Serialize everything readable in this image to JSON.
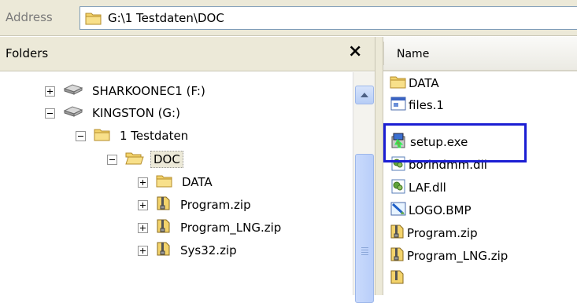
{
  "address": {
    "label": "Address",
    "path": "G:\\1 Testdaten\\DOC"
  },
  "folders_pane": {
    "title": "Folders",
    "close_glyph": "×",
    "tree": [
      {
        "label": "SHARKOONEC1 (F:)",
        "icon": "drive-icon",
        "expander": "plus"
      },
      {
        "label": "KINGSTON (G:)",
        "icon": "drive-icon",
        "expander": "minus"
      },
      {
        "label": "1 Testdaten",
        "icon": "folder-icon",
        "expander": "minus"
      },
      {
        "label": "DOC",
        "icon": "folder-open-icon",
        "expander": "minus",
        "selected": true
      },
      {
        "label": "DATA",
        "icon": "folder-icon",
        "expander": "plus"
      },
      {
        "label": "Program.zip",
        "icon": "zip-icon",
        "expander": "plus"
      },
      {
        "label": "Program_LNG.zip",
        "icon": "zip-icon",
        "expander": "plus"
      },
      {
        "label": "Sys32.zip",
        "icon": "zip-icon",
        "expander": "plus"
      }
    ]
  },
  "file_list": {
    "column_name": "Name",
    "items": [
      {
        "label": "DATA",
        "icon": "folder-icon"
      },
      {
        "label": "files.1",
        "icon": "file-window-icon"
      },
      {
        "label": "setup.exe",
        "icon": "setup-exe-icon",
        "highlighted": true
      },
      {
        "label": "borlndmm.dll",
        "icon": "dll-icon"
      },
      {
        "label": "LAF.dll",
        "icon": "dll-icon"
      },
      {
        "label": "LOGO.BMP",
        "icon": "bitmap-icon"
      },
      {
        "label": "Program.zip",
        "icon": "zip-icon"
      },
      {
        "label": "Program_LNG.zip",
        "icon": "zip-icon"
      }
    ]
  },
  "colors": {
    "highlight_border": "#1b1ed3",
    "chrome": "#ece9d8",
    "folder_yellow": "#f3d36b"
  }
}
